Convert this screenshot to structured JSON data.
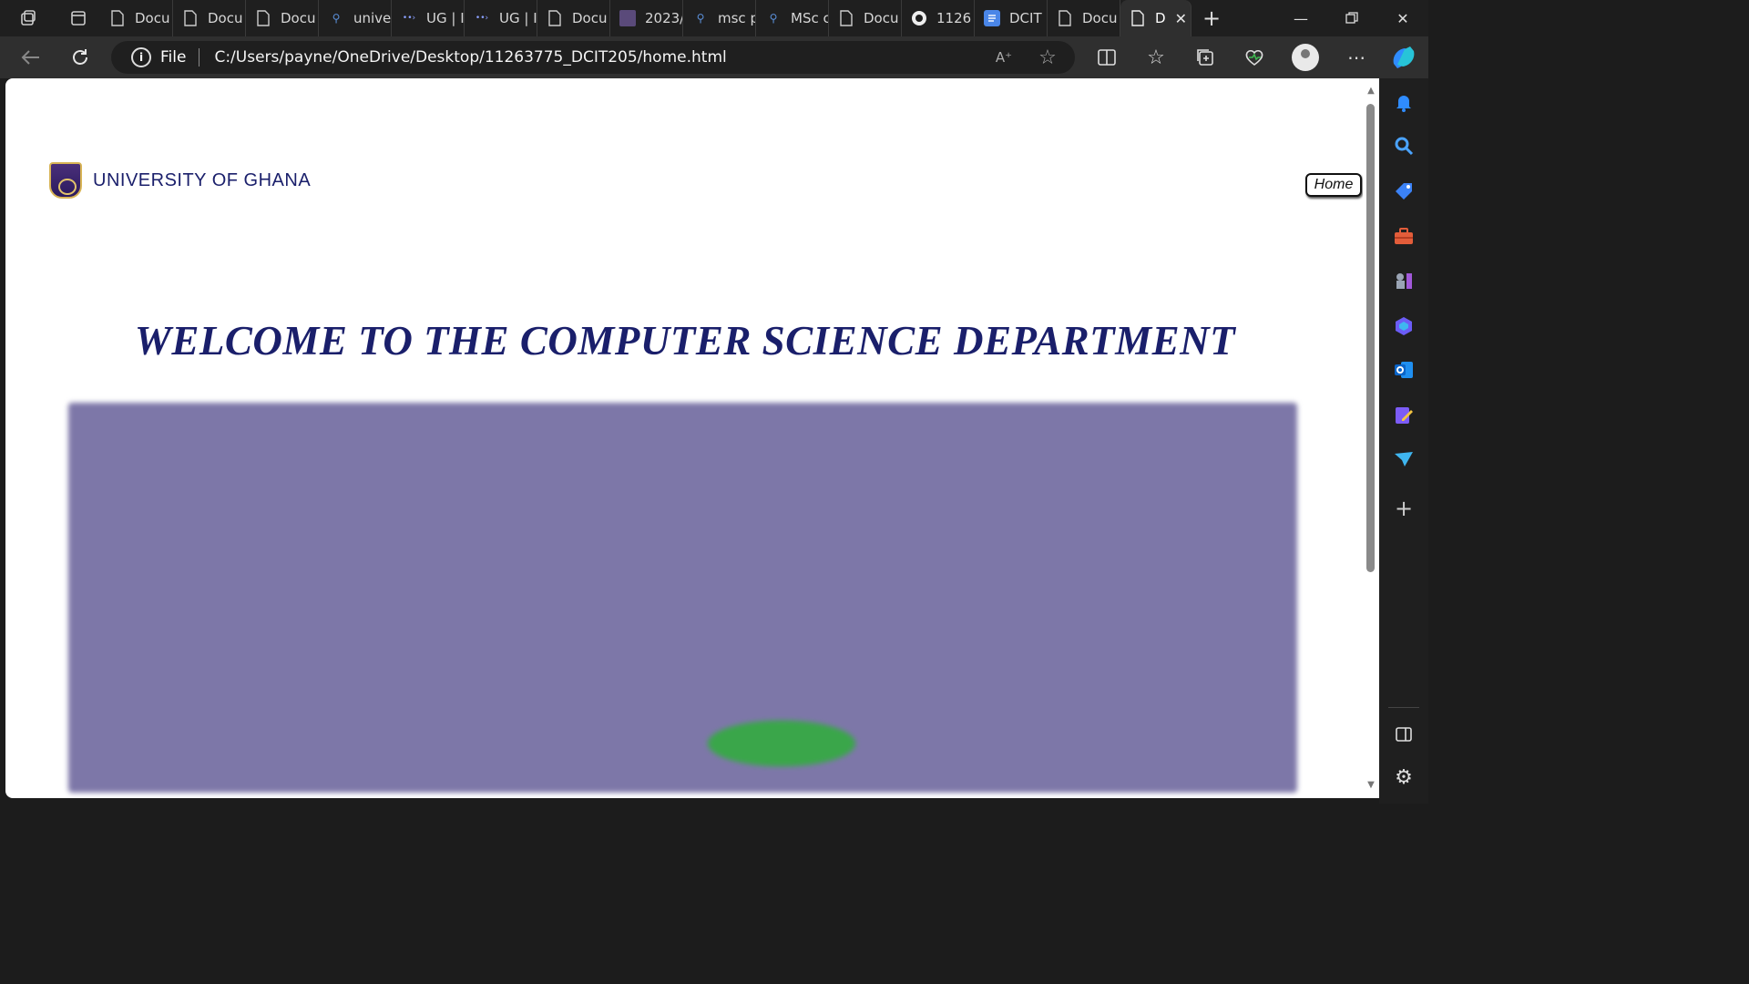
{
  "browser": {
    "tabs": [
      {
        "label": "Docu",
        "icon": "page-icon"
      },
      {
        "label": "Docu",
        "icon": "page-icon"
      },
      {
        "label": "Docu",
        "icon": "page-icon"
      },
      {
        "label": "unive",
        "icon": "search-icon"
      },
      {
        "label": "UG | I",
        "icon": "ug-icon"
      },
      {
        "label": "UG | I",
        "icon": "ug-icon"
      },
      {
        "label": "Docu",
        "icon": "page-icon"
      },
      {
        "label": "2023/",
        "icon": "crest-icon"
      },
      {
        "label": "msc p",
        "icon": "search-icon"
      },
      {
        "label": "MSc c",
        "icon": "search-icon"
      },
      {
        "label": "Docu",
        "icon": "page-icon"
      },
      {
        "label": "1126",
        "icon": "github-icon"
      },
      {
        "label": "DCIT",
        "icon": "docs-icon"
      },
      {
        "label": "Docu",
        "icon": "page-icon"
      }
    ],
    "active_tab": {
      "label": "D",
      "icon": "page-icon"
    },
    "address": {
      "scheme_label": "File",
      "url": "C:/Users/payne/OneDrive/Desktop/11263775_DCIT205/home.html"
    }
  },
  "page": {
    "brand_name": "UNIVERSITY OF GHANA",
    "nav": {
      "home_label": "Home"
    },
    "welcome": "WELCOME TO THE COMPUTER SCIENCE DEPARTMENT",
    "hero_image": "aerial-campus-photo"
  },
  "colors": {
    "brand": "#1a1f6b",
    "browser_chrome": "#1f1f1f",
    "toolbar": "#2f2f2f"
  }
}
